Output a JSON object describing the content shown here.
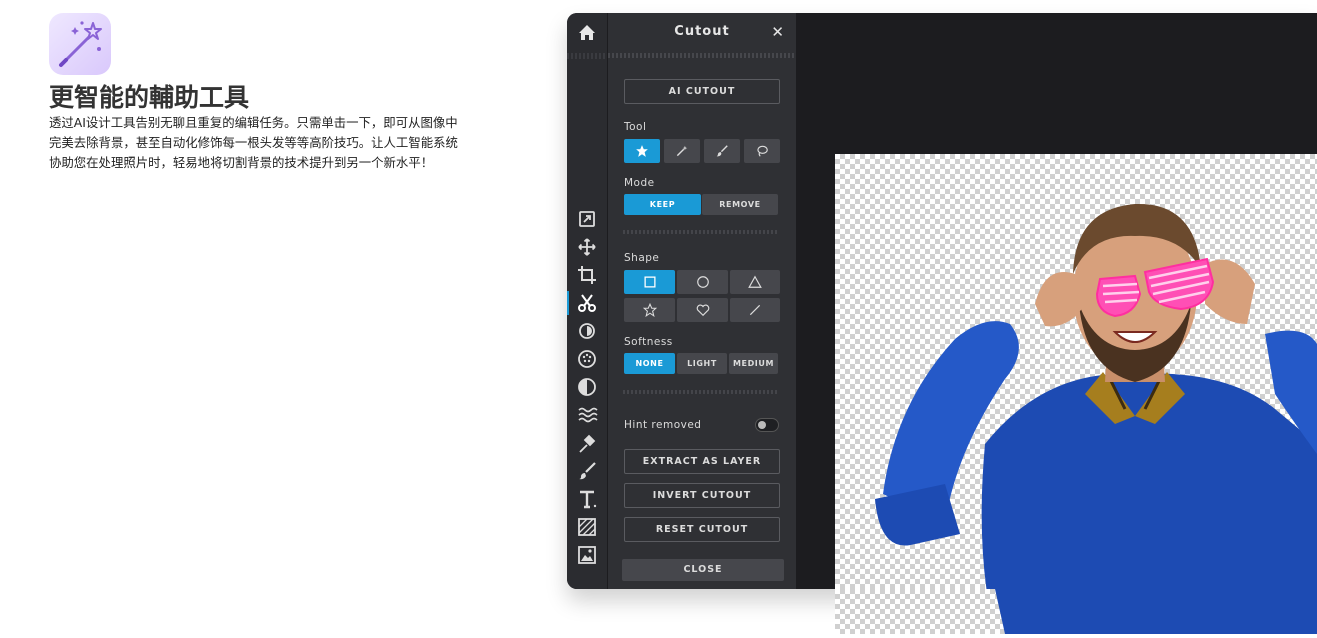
{
  "feature": {
    "icon": "magic-wand-icon",
    "title": "更智能的輔助工具",
    "description": "透过AI设计工具告别无聊且重复的编辑任务。只需单击一下，即可从图像中完美去除背景，甚至自动化修饰每一根头发等等高阶技巧。让人工智能系统协助您在处理照片时，轻易地将切割背景的技术提升到另一个新水平！"
  },
  "editor": {
    "home_icon": "home-icon",
    "toolbar_icons": [
      "adjust-arrow-icon",
      "move-icon",
      "crop-icon",
      "scissors-icon",
      "brightness-icon",
      "filter-dots-icon",
      "contrast-icon",
      "wave-icon",
      "pin-icon",
      "brush-icon",
      "text-icon",
      "texture-icon",
      "image-icon"
    ],
    "active_tool": "scissors-icon",
    "panel": {
      "title": "Cutout",
      "ai_cutout_label": "AI CUTOUT",
      "tool_label": "Tool",
      "tool_icons": [
        "star-icon",
        "magic-wand-icon",
        "brush-icon",
        "lasso-icon"
      ],
      "mode_label": "Mode",
      "mode_options": [
        "KEEP",
        "REMOVE"
      ],
      "mode_selected": "KEEP",
      "shape_label": "Shape",
      "shape_icons": [
        "square-icon",
        "circle-icon",
        "triangle-icon",
        "star-outline-icon",
        "heart-icon",
        "line-icon"
      ],
      "softness_label": "Softness",
      "softness_options": [
        "NONE",
        "LIGHT",
        "MEDIUM"
      ],
      "softness_selected": "NONE",
      "hint_label": "Hint removed",
      "hint_on": false,
      "extract_label": "EXTRACT AS LAYER",
      "invert_label": "INVERT CUTOUT",
      "reset_label": "RESET CUTOUT",
      "close_label": "CLOSE"
    },
    "canvas_image": "man-with-pink-glasses-illustration"
  },
  "colors": {
    "accent": "#1a9ad6",
    "panel": "#2f3034",
    "rail": "#2b2c30",
    "workspace": "#1c1c1f",
    "icon_bg": "#e6dcfc"
  }
}
